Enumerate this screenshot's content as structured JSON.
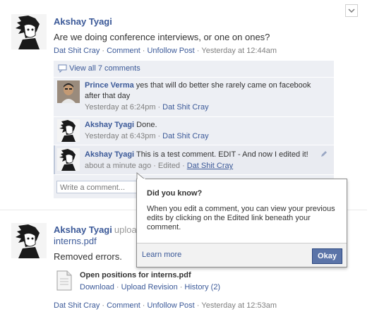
{
  "post1": {
    "author": "Akshay Tyagi",
    "message": "Are we doing conference interviews, or one on ones?",
    "meta": {
      "group": "Dat Shit Cray",
      "comment": "Comment",
      "unfollow": "Unfollow Post",
      "time": "Yesterday at 12:44am"
    },
    "view_all": "View all 7 comments",
    "comments": [
      {
        "author": "Prince Verma",
        "text": "yes that will do better she rarely came on facebook after that day",
        "time": "Yesterday at 6:24pm",
        "group": "Dat Shit Cray"
      },
      {
        "author": "Akshay Tyagi",
        "text": "Done.",
        "time": "Yesterday at 6:43pm",
        "group": "Dat Shit Cray"
      },
      {
        "author": "Akshay Tyagi",
        "text": "This is a test comment. EDIT - And now I edited it!",
        "time": "about a minute ago",
        "edited": "Edited",
        "group": "Dat Shit Cray"
      }
    ],
    "comment_placeholder": "Write a comment..."
  },
  "tooltip": {
    "title": "Did you know?",
    "body": "When you edit a comment, you can view your previous edits by clicking on the Edited link beneath your comment.",
    "learn_more": "Learn more",
    "okay": "Okay"
  },
  "post2": {
    "author": "Akshay Tyagi",
    "action": "uploa",
    "file_link": "interns.pdf",
    "message": "Removed errors.",
    "file": {
      "name": "Open positions for interns.pdf",
      "download": "Download",
      "upload": "Upload Revision",
      "history": "History (2)"
    },
    "meta": {
      "group": "Dat Shit Cray",
      "comment": "Comment",
      "unfollow": "Unfollow Post",
      "time": "Yesterday at 12:53am"
    }
  },
  "colors": {
    "link": "#3b5998",
    "panel": "#edeff4",
    "button": "#5b74a8"
  },
  "icons": [
    "chevron-down-icon",
    "comment-bubble-icon",
    "pencil-icon",
    "document-icon"
  ]
}
